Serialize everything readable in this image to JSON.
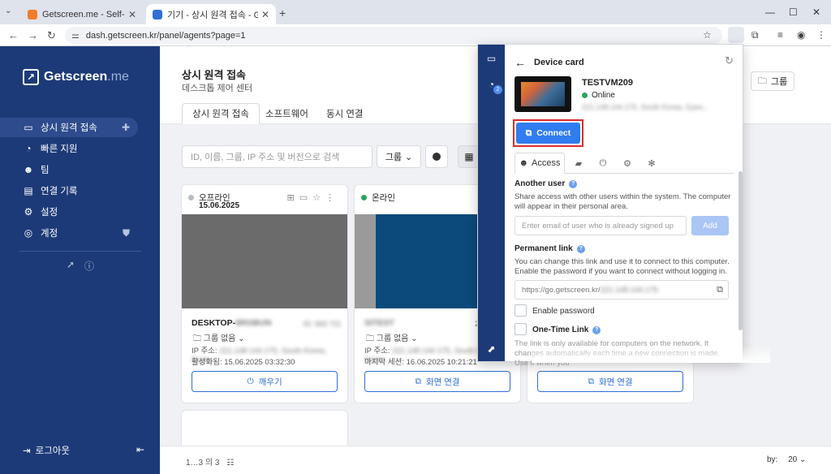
{
  "browser": {
    "tabs": [
      {
        "title": "Getscreen.me - Self-Hosted - ",
        "close": "✕"
      },
      {
        "title": "기기 - 상시 원격 접속 - Getscre",
        "close": "✕"
      }
    ],
    "url": "dash.getscreen.kr/panel/agents?page=1",
    "icons": {
      "back": "←",
      "forward": "→",
      "reload": "↻",
      "star": "☆",
      "new_tab": "+"
    }
  },
  "sidebar": {
    "brand": "Getscreen",
    "brand_suffix": ".me",
    "items": [
      {
        "label": "상시 원격 접속",
        "icon": "monitor-icon"
      },
      {
        "label": "빠른 지원",
        "icon": "gauge-icon"
      },
      {
        "label": "팀",
        "icon": "team-icon"
      },
      {
        "label": "연결 기록",
        "icon": "history-icon"
      },
      {
        "label": "설정",
        "icon": "gear-icon"
      },
      {
        "label": "계정",
        "icon": "account-icon"
      }
    ],
    "logout": "로그아웃"
  },
  "header": {
    "title": "상시 원격 접속",
    "subtitle": "데스크톱 제어 센터",
    "tabs": [
      "상시 원격 접속",
      "소프트웨어",
      "동시 연결"
    ],
    "group_button": "그룹"
  },
  "filters": {
    "search_placeholder": "ID, 이름, 그룹, IP 주소 및 버전으로 검색",
    "group_select": "그룹"
  },
  "cards": [
    {
      "status": "오프라인",
      "status_color": "#b8bcc4",
      "date": "15.06.2025",
      "name": "DESKTOP-",
      "name_hidden": "6RGBUN",
      "side_hidden": "ID: 665 721",
      "group": "그룹 없음",
      "ip_label": "IP 주소:",
      "ip_hidden": "221.148.144.175, South Korea, Gyeo...",
      "activity": "활성화됨: 15.06.2025 03:32:30",
      "button": "깨우기"
    },
    {
      "status": "온라인",
      "status_color": "#29a35a",
      "date": "",
      "name": "",
      "name_hidden": "SITEST",
      "side_hidden": "2",
      "group": "그룹 없음",
      "ip_label": "IP 주소:",
      "ip_hidden": "221.148.144.175, South Korea, Gyeo...",
      "activity": "마지막 세션: 16.06.2025 10:21:21",
      "button": "화면 연결"
    },
    {
      "button": "화면 연결"
    }
  ],
  "footer": {
    "pager": "1…3 의 3",
    "by_label": "by:",
    "by_value": "20"
  },
  "popup": {
    "title": "Device card",
    "device_name": "TESTVM209",
    "device_status": "Online",
    "device_info_hidden": "221.148.144.175, South Korea, Gyeo...",
    "badge": "2",
    "connect": "Connect",
    "tabs": {
      "access": "Access"
    },
    "another_user_title": "Another user",
    "another_user_text": "Share access with other users within the system. The computer will appear in their personal area.",
    "email_placeholder": "Enter email of user who is already signed up",
    "add": "Add",
    "permanent_title": "Permanent link",
    "permanent_text": "You can change this link and use it to connect to this computer. Enable the password if you want to connect without logging in.",
    "link_value": "https://go.getscreen.kr/",
    "link_hidden": "221.148.144.175",
    "enable_password": "Enable password",
    "one_time_title": "One-Time Link",
    "one_time_text": "The link is only available for computers on the network. It changes automatically each time a new connection is made. Use it when you"
  }
}
